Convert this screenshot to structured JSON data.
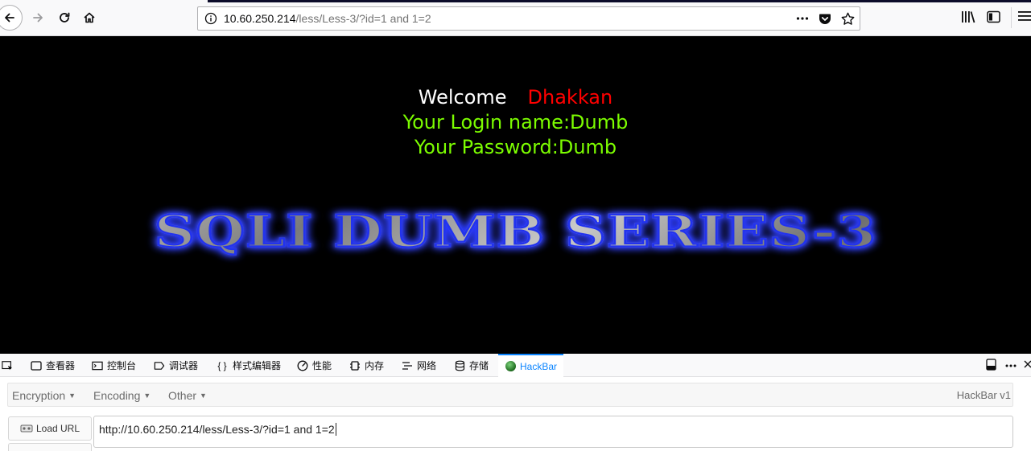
{
  "browser": {
    "url_host": "10.60.250.214",
    "url_path": "/less/Less-3/?id=1 and 1=2"
  },
  "page": {
    "welcome": "Welcome",
    "name": "Dhakkan",
    "login_line": "Your Login name:Dumb",
    "password_line": "Your Password:Dumb",
    "banner": "SQLI DUMB SERIES-3",
    "colors": {
      "background": "#000000",
      "name": "#ff0000",
      "credentials": "#7cfc00"
    }
  },
  "devtools": {
    "tabs": [
      {
        "label": "查看器",
        "icon": "inspector-icon"
      },
      {
        "label": "控制台",
        "icon": "console-icon"
      },
      {
        "label": "调试器",
        "icon": "debugger-icon"
      },
      {
        "label": "样式编辑器",
        "icon": "style-editor-icon"
      },
      {
        "label": "性能",
        "icon": "performance-icon"
      },
      {
        "label": "内存",
        "icon": "memory-icon"
      },
      {
        "label": "网络",
        "icon": "network-icon"
      },
      {
        "label": "存储",
        "icon": "storage-icon"
      },
      {
        "label": "HackBar",
        "icon": "hackbar-icon",
        "active": true
      }
    ]
  },
  "hackbar": {
    "menus": [
      "Encryption",
      "Encoding",
      "Other"
    ],
    "version": "HackBar v1",
    "load_url": "Load URL",
    "url_value": "http://10.60.250.214/less/Less-3/?id=1 and 1=2"
  }
}
